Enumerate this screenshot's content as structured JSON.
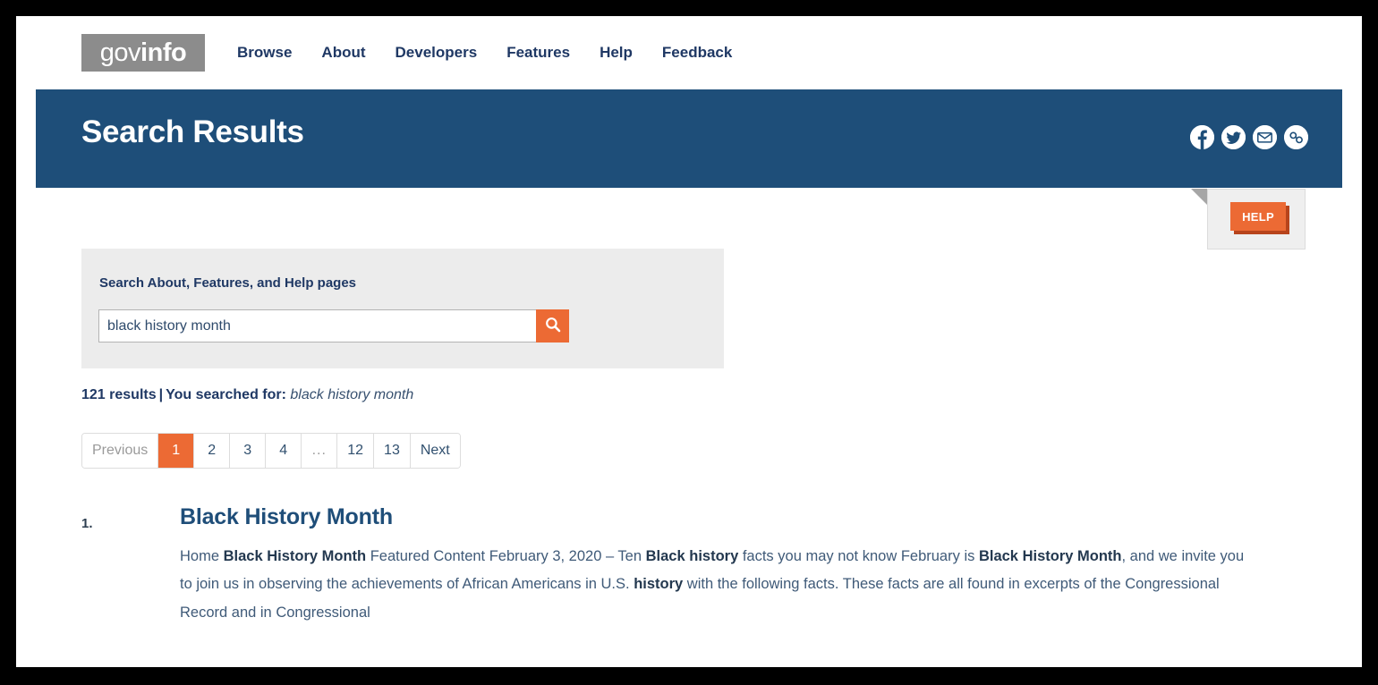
{
  "topnav": {
    "logo": {
      "light": "gov",
      "bold": "info"
    },
    "links": [
      {
        "label": "Browse"
      },
      {
        "label": "About"
      },
      {
        "label": "Developers"
      },
      {
        "label": "Features"
      },
      {
        "label": "Help"
      },
      {
        "label": "Feedback"
      }
    ]
  },
  "banner": {
    "title": "Search Results",
    "social": [
      {
        "name": "facebook-icon"
      },
      {
        "name": "twitter-icon"
      },
      {
        "name": "email-icon"
      },
      {
        "name": "link-icon"
      }
    ]
  },
  "help_tab": {
    "label": "HELP"
  },
  "search": {
    "label": "Search About, Features, and Help pages",
    "value": "black history month",
    "placeholder": "",
    "button_icon": "search-icon"
  },
  "results_meta": {
    "count": "121 results",
    "separator": "|",
    "searched_for_label": "You searched for:",
    "query": "black history month"
  },
  "pagination": {
    "previous": "Previous",
    "next": "Next",
    "pages": [
      "1",
      "2",
      "3",
      "4",
      "...",
      "12",
      "13"
    ],
    "active": "1"
  },
  "results": [
    {
      "number": "1.",
      "title": "Black History Month",
      "snippet_parts": [
        {
          "text": "Home ",
          "bold": false
        },
        {
          "text": "Black History Month",
          "bold": true
        },
        {
          "text": " Featured Content February 3, 2020 – Ten ",
          "bold": false
        },
        {
          "text": "Black history",
          "bold": true
        },
        {
          "text": " facts you may not know February is ",
          "bold": false
        },
        {
          "text": "Black History Month",
          "bold": true
        },
        {
          "text": ", and we invite you to join us in observing the achievements of African Americans in U.S. ",
          "bold": false
        },
        {
          "text": "history",
          "bold": true
        },
        {
          "text": " with the following facts. These facts are all found in excerpts of the Congressional Record and in Congressional",
          "bold": false
        }
      ]
    }
  ],
  "colors": {
    "banner_navy": "#1e4e79",
    "accent_orange": "#ec6a34",
    "orange_shadow": "#b7441c",
    "logo_gray": "#8c8c8c",
    "panel_gray": "#ececec",
    "link_navy": "#1f4e79",
    "text_navy": "#1f3864",
    "snippet_blue": "#3f5a78"
  }
}
